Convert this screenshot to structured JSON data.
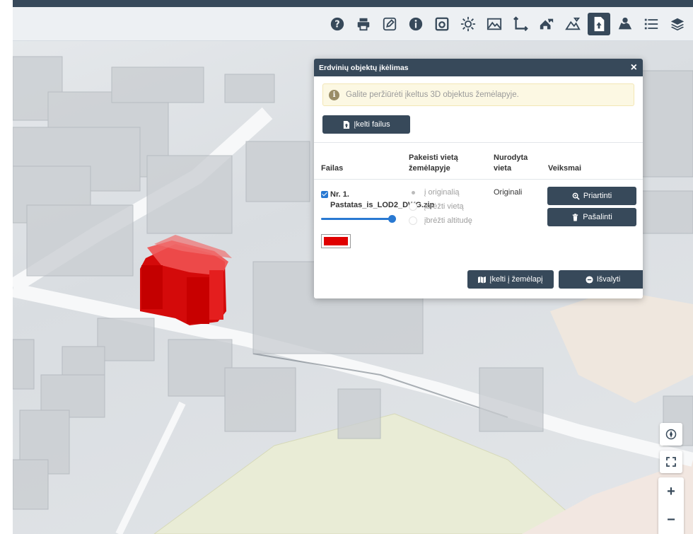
{
  "toolbar": {
    "tools": [
      {
        "name": "help-icon"
      },
      {
        "name": "print-icon"
      },
      {
        "name": "edit-icon"
      },
      {
        "name": "info-icon"
      },
      {
        "name": "camera-icon"
      },
      {
        "name": "sun-icon"
      },
      {
        "name": "terrain-icon"
      },
      {
        "name": "measure-icon"
      },
      {
        "name": "buildings-icon"
      },
      {
        "name": "layers-3d-icon"
      },
      {
        "name": "upload-object-icon",
        "active": true
      },
      {
        "name": "map-pin-icon"
      },
      {
        "name": "list-icon"
      },
      {
        "name": "stack-icon"
      }
    ]
  },
  "dialog": {
    "title": "Erdvinių objektų įkėlimas",
    "close": "×",
    "info_text": "Galite peržiūrėti įkeltus 3D objektus žemėlapyje.",
    "upload_label": "Įkelti failus",
    "headers": {
      "file": "Failas",
      "change_location_1": "Pakeisti vietą",
      "change_location_2": "žemėlapyje",
      "specified_1": "Nurodyta",
      "specified_2": "vieta",
      "actions": "Veiksmai"
    },
    "row": {
      "file_name": "Nr. 1. Pastatas_is_LOD2_DWG.zip",
      "checked": true,
      "opacity": 1.0,
      "color": "#e00000",
      "options": [
        "į originalią",
        "įbrėžti vietą",
        "įbrėžti altitudę"
      ],
      "selected_option": 0,
      "location": "Originali",
      "zoom_label": "Priartinti",
      "remove_label": "Pašalinti"
    },
    "load_map_label": "Įkelti į žemėlapį",
    "clear_label": "Išvalyti"
  },
  "map_controls": {
    "zoom_in": "+",
    "zoom_out": "−"
  },
  "colors": {
    "primary": "#37495a",
    "accent": "#2979d2",
    "model": "#e00000"
  }
}
